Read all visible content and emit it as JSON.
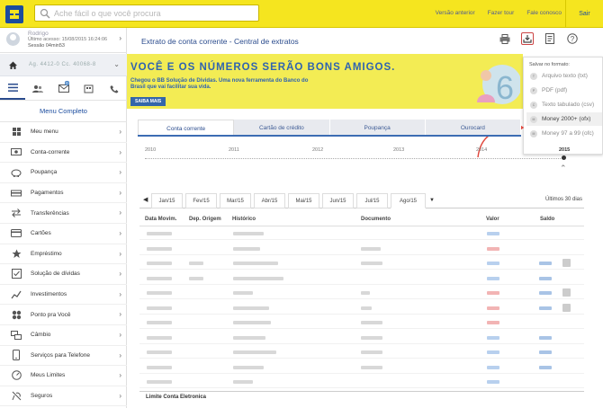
{
  "topbar": {
    "search_placeholder": "Ache fácil o que você procura",
    "links": [
      "Versão anterior",
      "Fazer tour",
      "Fale conosco"
    ],
    "logout": "Sair"
  },
  "user": {
    "name": "Rodrigo",
    "last_access": "Último acesso: 15/08/2015 16:24:06",
    "session": "Sessão 04min53",
    "account_masked": "Ag. 4412-0  Cc. 40068-8"
  },
  "sidebar": {
    "menu_completo": "Menu Completo",
    "badge_count": "0",
    "items": [
      {
        "label": "Meu menu",
        "icon": "my-menu-icon"
      },
      {
        "label": "Conta-corrente",
        "icon": "checking-account-icon"
      },
      {
        "label": "Poupança",
        "icon": "savings-piggy-icon"
      },
      {
        "label": "Pagamentos",
        "icon": "payments-icon"
      },
      {
        "label": "Transferências",
        "icon": "transfers-icon"
      },
      {
        "label": "Cartões",
        "icon": "cards-icon"
      },
      {
        "label": "Empréstimo",
        "icon": "loan-icon"
      },
      {
        "label": "Solução de dívidas",
        "icon": "debt-solution-icon"
      },
      {
        "label": "Investimentos",
        "icon": "investments-icon"
      },
      {
        "label": "Ponto pra Você",
        "icon": "points-icon"
      },
      {
        "label": "Câmbio",
        "icon": "exchange-icon"
      },
      {
        "label": "Serviços para Telefone",
        "icon": "phone-services-icon"
      },
      {
        "label": "Meus Limites",
        "icon": "limits-icon"
      },
      {
        "label": "Seguros",
        "icon": "insurance-icon"
      }
    ]
  },
  "main": {
    "title": "Extrato de conta corrente - Central de extratos",
    "banner": {
      "headline": "VOCÊ E OS NÚMEROS SERÃO BONS AMIGOS.",
      "text": "Chegou o BB Solução de Dívidas. Uma nova ferramenta do Banco do Brasil que vai facilitar sua vida.",
      "button": "SAIBA MAIS"
    },
    "save_menu": {
      "header": "Salvar no formato:",
      "options": [
        {
          "label": "Arquivo texto (txt)",
          "icon_text": "T"
        },
        {
          "label": "PDF (pdf)",
          "icon_text": "P"
        },
        {
          "label": "Texto tabulado (csv)",
          "icon_text": "C"
        },
        {
          "label": "Money 2000+ (ofx)",
          "icon_text": "M"
        },
        {
          "label": "Money 97 a 99 (ofc)",
          "icon_text": "M"
        }
      ]
    },
    "tabs": [
      "Conta corrente",
      "Cartão de crédito",
      "Poupança",
      "Ourocard"
    ],
    "years": [
      "2010",
      "2011",
      "2012",
      "2013",
      "2014",
      "2015"
    ],
    "months": [
      "Jan/15",
      "Fev/15",
      "Mar/15",
      "Abr/15",
      "Mai/15",
      "Jun/15",
      "Jul/15",
      "Ago/15"
    ],
    "last_days": "Últimos 30 dias",
    "table_headers": [
      "Data Movim.",
      "Dep. Origem",
      "Histórico",
      "Documento",
      "Valor",
      "Saldo"
    ],
    "footer": "Limite Conta Eletronica"
  }
}
